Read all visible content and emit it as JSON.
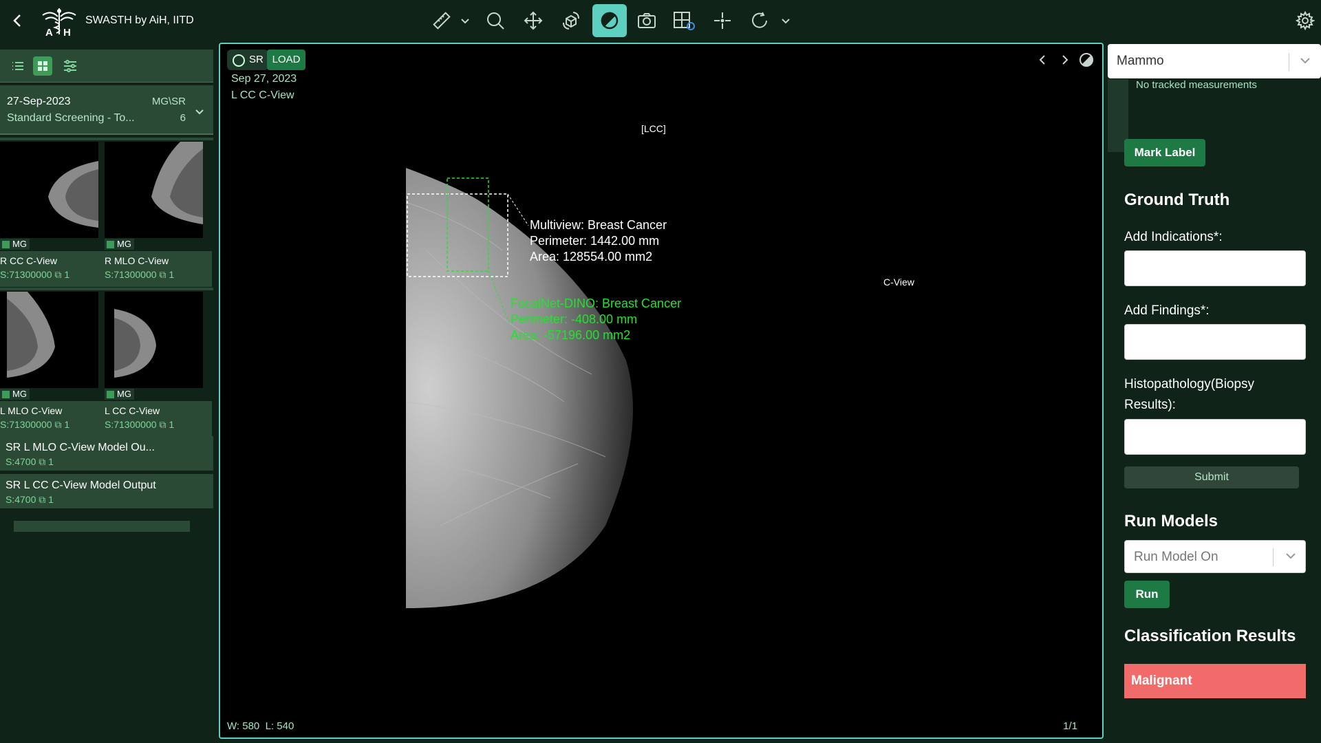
{
  "header": {
    "title": "SWASTH by AiH, IITD",
    "logo_text": "AiH"
  },
  "toolbar": {
    "tools": [
      "measure-ruler-icon",
      "zoom-icon",
      "pan-icon",
      "3d-rotate-icon",
      "window-level-icon",
      "camera-icon",
      "layout-icon",
      "crosshair-icon",
      "reset-icon"
    ],
    "active_tool": "window-level-icon"
  },
  "study": {
    "date": "27-Sep-2023",
    "description": "Standard Screening - To...",
    "modality": "MG\\SR",
    "count": "6"
  },
  "thumbnails": [
    {
      "modality": "MG",
      "name": "R CC C-View",
      "series": "S:71300000",
      "count": "1"
    },
    {
      "modality": "MG",
      "name": "R MLO C-View",
      "series": "S:71300000",
      "count": "1"
    },
    {
      "modality": "MG",
      "name": "L MLO C-View",
      "series": "S:71300000",
      "count": "1"
    },
    {
      "modality": "MG",
      "name": "L CC C-View",
      "series": "S:71300000",
      "count": "1"
    }
  ],
  "sr_series": [
    {
      "title": "SR  L MLO C-View Model Ou...",
      "series": "S:4700",
      "count": "1"
    },
    {
      "title": "SR  L CC C-View Model Output",
      "series": "S:4700",
      "count": "1"
    }
  ],
  "viewport": {
    "sr_label": "SR",
    "load_label": "LOAD",
    "date": "Sep 27, 2023",
    "view": "L CC C-View",
    "orientation": "LCC",
    "side_label": "C-View",
    "multiview": {
      "line1": "Multiview: Breast Cancer",
      "line2": "Perimeter: 1442.00 mm",
      "line3": "Area: 128554.00 mm2"
    },
    "focalnet": {
      "line1": "FocalNet-DINO: Breast Cancer",
      "line2": "Perimeter: -408.00 mm",
      "line3": "Area: -57196.00 mm2"
    },
    "window_width": "W:  580",
    "window_level": "L:  540",
    "page": "1/1",
    "annotation_colors": {
      "multiview": "#ffffff",
      "focalnet": "#1ee52c"
    }
  },
  "right_panel": {
    "mode_select": "Mammo",
    "measurements_text": "No tracked measurements",
    "mark_label": "Mark Label",
    "ground_truth_heading": "Ground Truth",
    "indications_label": "Add Indications*:",
    "findings_label": "Add Findings*:",
    "histopathology_label": "Histopathology(Biopsy Results):",
    "submit_label": "Submit",
    "run_models_heading": "Run Models",
    "run_model_placeholder": "Run Model On",
    "run_label": "Run",
    "classification_heading": "Classification Results",
    "classification_result": "Malignant",
    "result_color": "#f26b6b"
  }
}
